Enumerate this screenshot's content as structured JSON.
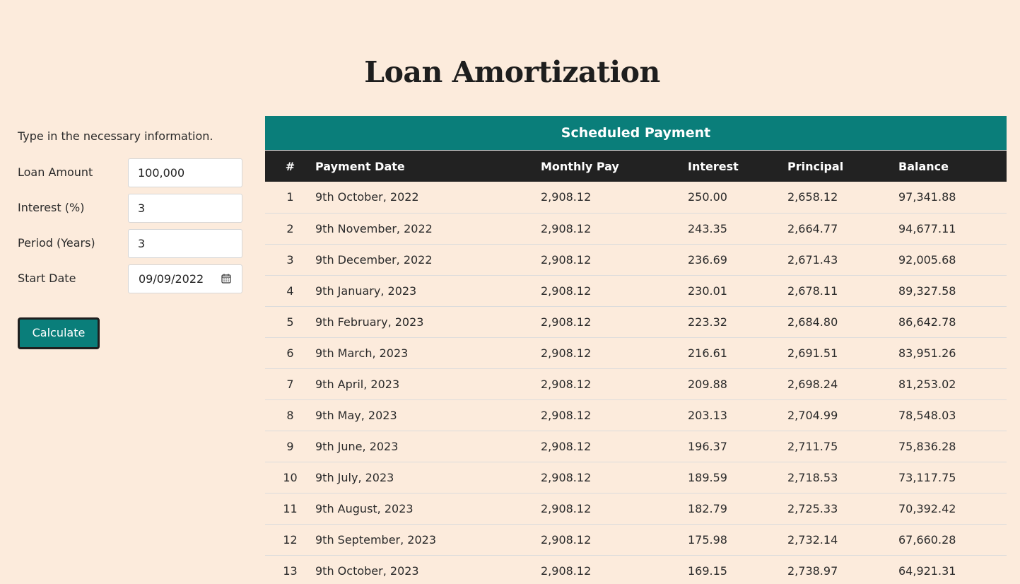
{
  "page": {
    "title": "Loan Amortization"
  },
  "form": {
    "instructions": "Type in the necessary information.",
    "fields": [
      {
        "label": "Loan Amount",
        "value": "100,000"
      },
      {
        "label": "Interest (%)",
        "value": "3"
      },
      {
        "label": "Period (Years)",
        "value": "3"
      },
      {
        "label": "Start Date",
        "value": "09/09/2022"
      }
    ],
    "calculate_label": "Calculate"
  },
  "table": {
    "caption": "Scheduled Payment",
    "columns": [
      "#",
      "Payment Date",
      "Monthly Pay",
      "Interest",
      "Principal",
      "Balance"
    ],
    "rows": [
      [
        "1",
        "9th October, 2022",
        "2,908.12",
        "250.00",
        "2,658.12",
        "97,341.88"
      ],
      [
        "2",
        "9th November, 2022",
        "2,908.12",
        "243.35",
        "2,664.77",
        "94,677.11"
      ],
      [
        "3",
        "9th December, 2022",
        "2,908.12",
        "236.69",
        "2,671.43",
        "92,005.68"
      ],
      [
        "4",
        "9th January, 2023",
        "2,908.12",
        "230.01",
        "2,678.11",
        "89,327.58"
      ],
      [
        "5",
        "9th February, 2023",
        "2,908.12",
        "223.32",
        "2,684.80",
        "86,642.78"
      ],
      [
        "6",
        "9th March, 2023",
        "2,908.12",
        "216.61",
        "2,691.51",
        "83,951.26"
      ],
      [
        "7",
        "9th April, 2023",
        "2,908.12",
        "209.88",
        "2,698.24",
        "81,253.02"
      ],
      [
        "8",
        "9th May, 2023",
        "2,908.12",
        "203.13",
        "2,704.99",
        "78,548.03"
      ],
      [
        "9",
        "9th June, 2023",
        "2,908.12",
        "196.37",
        "2,711.75",
        "75,836.28"
      ],
      [
        "10",
        "9th July, 2023",
        "2,908.12",
        "189.59",
        "2,718.53",
        "73,117.75"
      ],
      [
        "11",
        "9th August, 2023",
        "2,908.12",
        "182.79",
        "2,725.33",
        "70,392.42"
      ],
      [
        "12",
        "9th September, 2023",
        "2,908.12",
        "175.98",
        "2,732.14",
        "67,660.28"
      ],
      [
        "13",
        "9th October, 2023",
        "2,908.12",
        "169.15",
        "2,738.97",
        "64,921.31"
      ]
    ]
  },
  "colors": {
    "background": "#fcebdc",
    "accent": "#0a7e7a",
    "header_dark": "#222222"
  }
}
